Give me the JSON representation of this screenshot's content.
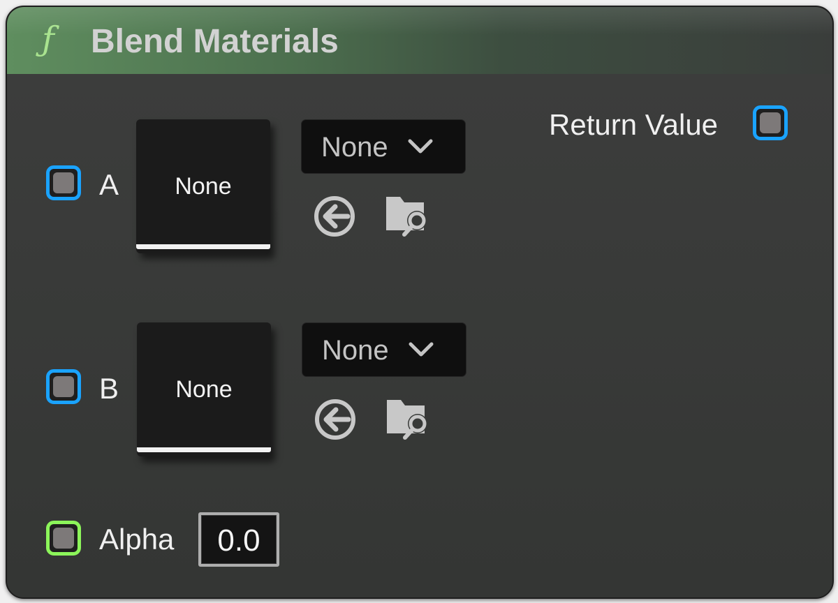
{
  "node": {
    "title": "Blend Materials",
    "function_icon": "function-f-icon",
    "glyph": "ƒ",
    "header_color": "#5f8e5f"
  },
  "inputs": [
    {
      "pin_label": "A",
      "pin_color": "#1aa3ff",
      "thumbnail_label": "None",
      "dropdown_value": "None",
      "icons": [
        "use-selected-asset-icon",
        "browse-asset-icon"
      ]
    },
    {
      "pin_label": "B",
      "pin_color": "#1aa3ff",
      "thumbnail_label": "None",
      "dropdown_value": "None",
      "icons": [
        "use-selected-asset-icon",
        "browse-asset-icon"
      ]
    }
  ],
  "alpha": {
    "pin_label": "Alpha",
    "pin_color": "#8cf55a",
    "value": "0.0"
  },
  "output": {
    "pin_label": "Return Value",
    "pin_color": "#1aa3ff"
  }
}
